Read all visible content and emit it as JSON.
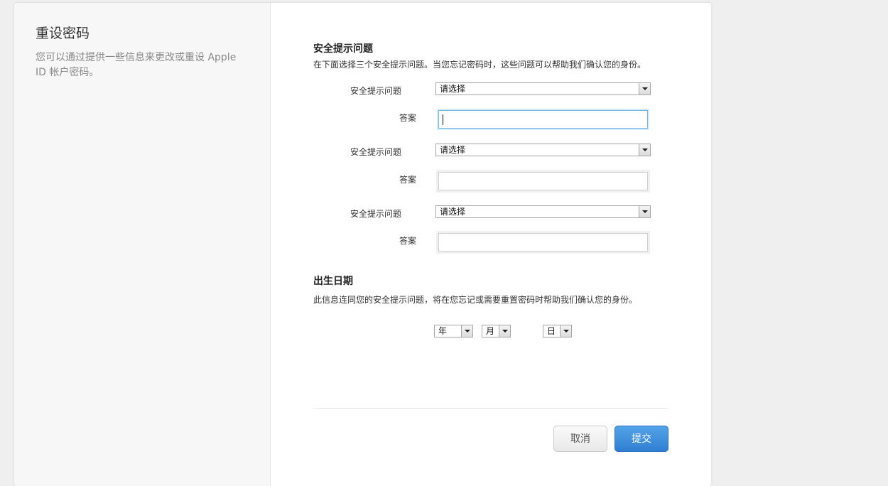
{
  "sidebar": {
    "title": "重设密码",
    "description": "您可以通过提供一些信息来更改或重设 Apple ID 帐户密码。"
  },
  "security": {
    "title": "安全提示问题",
    "description": "在下面选择三个安全提示问题。当您忘记密码时，这些问题可以帮助我们确认您的身份。",
    "question_label": "安全提示问题",
    "answer_label": "答案",
    "select_placeholder": "请选择",
    "answers": [
      "",
      "",
      ""
    ]
  },
  "birthday": {
    "title": "出生日期",
    "description": "此信息连同您的安全提示问题，将在您忘记或需要重置密码时帮助我们确认您的身份。",
    "year": "年",
    "month": "月",
    "day": "日"
  },
  "actions": {
    "cancel": "取消",
    "submit": "提交"
  }
}
